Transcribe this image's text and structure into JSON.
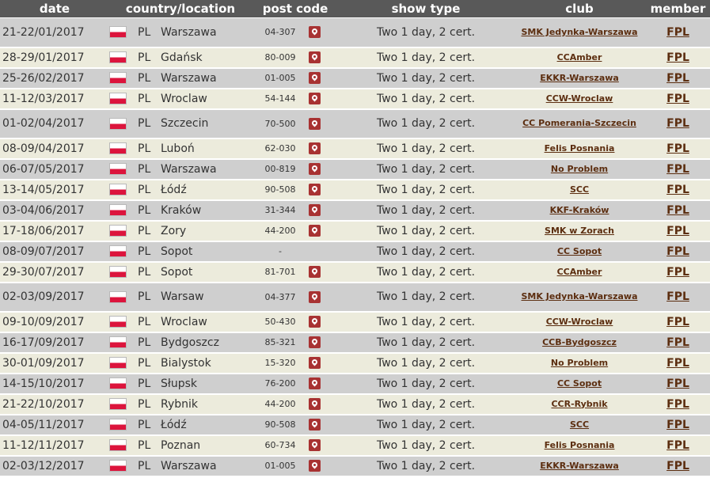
{
  "header": {
    "date": "date",
    "country": "country/location",
    "post": "post code",
    "type": "show type",
    "club": "club",
    "member": "member"
  },
  "colors": {
    "header_bg": "#595959",
    "row_odd": "#cfcfcf",
    "row_even": "#ecebdc",
    "link": "#5c2e10",
    "pin": "#a83232",
    "flag_red": "#dc143c"
  },
  "rows": [
    {
      "date": "21-22/01/2017",
      "country": "PL",
      "city": "Warszawa",
      "post": "04-307",
      "pin": true,
      "type": "Two 1 day, 2 cert.",
      "club": "SMK Jedynka-Warszawa",
      "member": "FPL",
      "tall": true
    },
    {
      "date": "28-29/01/2017",
      "country": "PL",
      "city": "Gdańsk",
      "post": "80-009",
      "pin": true,
      "type": "Two 1 day, 2 cert.",
      "club": "CCAmber",
      "member": "FPL",
      "tall": false
    },
    {
      "date": "25-26/02/2017",
      "country": "PL",
      "city": "Warszawa",
      "post": "01-005",
      "pin": true,
      "type": "Two 1 day, 2 cert.",
      "club": "EKKR-Warszawa",
      "member": "FPL",
      "tall": false
    },
    {
      "date": "11-12/03/2017",
      "country": "PL",
      "city": "Wroclaw",
      "post": "54-144",
      "pin": true,
      "type": "Two 1 day, 2 cert.",
      "club": "CCW-Wroclaw",
      "member": "FPL",
      "tall": false
    },
    {
      "date": "01-02/04/2017",
      "country": "PL",
      "city": "Szczecin",
      "post": "70-500",
      "pin": true,
      "type": "Two 1 day, 2 cert.",
      "club": "CC Pomerania-Szczecin",
      "member": "FPL",
      "tall": true
    },
    {
      "date": "08-09/04/2017",
      "country": "PL",
      "city": "Luboń",
      "post": "62-030",
      "pin": true,
      "type": "Two 1 day, 2 cert.",
      "club": "Felis Posnania",
      "member": "FPL",
      "tall": false
    },
    {
      "date": "06-07/05/2017",
      "country": "PL",
      "city": "Warszawa",
      "post": "00-819",
      "pin": true,
      "type": "Two 1 day, 2 cert.",
      "club": "No Problem",
      "member": "FPL",
      "tall": false
    },
    {
      "date": "13-14/05/2017",
      "country": "PL",
      "city": "Łódź",
      "post": "90-508",
      "pin": true,
      "type": "Two 1 day, 2 cert.",
      "club": "SCC",
      "member": "FPL",
      "tall": false
    },
    {
      "date": "03-04/06/2017",
      "country": "PL",
      "city": "Kraków",
      "post": "31-344",
      "pin": true,
      "type": "Two 1 day, 2 cert.",
      "club": "KKF-Kraków",
      "member": "FPL",
      "tall": false
    },
    {
      "date": "17-18/06/2017",
      "country": "PL",
      "city": "Zory",
      "post": "44-200",
      "pin": true,
      "type": "Two 1 day, 2 cert.",
      "club": "SMK w Zorach",
      "member": "FPL",
      "tall": false
    },
    {
      "date": "08-09/07/2017",
      "country": "PL",
      "city": "Sopot",
      "post": "-",
      "pin": false,
      "type": "Two 1 day, 2 cert.",
      "club": "CC Sopot",
      "member": "FPL",
      "tall": false
    },
    {
      "date": "29-30/07/2017",
      "country": "PL",
      "city": "Sopot",
      "post": "81-701",
      "pin": true,
      "type": "Two 1 day, 2 cert.",
      "club": "CCAmber",
      "member": "FPL",
      "tall": false
    },
    {
      "date": "02-03/09/2017",
      "country": "PL",
      "city": "Warsaw",
      "post": "04-377",
      "pin": true,
      "type": "Two 1 day, 2 cert.",
      "club": "SMK Jedynka-Warszawa",
      "member": "FPL",
      "tall": true
    },
    {
      "date": "09-10/09/2017",
      "country": "PL",
      "city": "Wroclaw",
      "post": "50-430",
      "pin": true,
      "type": "Two 1 day, 2 cert.",
      "club": "CCW-Wroclaw",
      "member": "FPL",
      "tall": false
    },
    {
      "date": "16-17/09/2017",
      "country": "PL",
      "city": "Bydgoszcz",
      "post": "85-321",
      "pin": true,
      "type": "Two 1 day, 2 cert.",
      "club": "CCB-Bydgoszcz",
      "member": "FPL",
      "tall": false
    },
    {
      "date": "30-01/09/2017",
      "country": "PL",
      "city": "Bialystok",
      "post": "15-320",
      "pin": true,
      "type": "Two 1 day, 2 cert.",
      "club": "No Problem",
      "member": "FPL",
      "tall": false
    },
    {
      "date": "14-15/10/2017",
      "country": "PL",
      "city": "Słupsk",
      "post": "76-200",
      "pin": true,
      "type": "Two 1 day, 2 cert.",
      "club": "CC Sopot",
      "member": "FPL",
      "tall": false
    },
    {
      "date": "21-22/10/2017",
      "country": "PL",
      "city": "Rybnik",
      "post": "44-200",
      "pin": true,
      "type": "Two 1 day, 2 cert.",
      "club": "CCR-Rybnik",
      "member": "FPL",
      "tall": false
    },
    {
      "date": "04-05/11/2017",
      "country": "PL",
      "city": "Łódź",
      "post": "90-508",
      "pin": true,
      "type": "Two 1 day, 2 cert.",
      "club": "SCC",
      "member": "FPL",
      "tall": false
    },
    {
      "date": "11-12/11/2017",
      "country": "PL",
      "city": "Poznan",
      "post": "60-734",
      "pin": true,
      "type": "Two 1 day, 2 cert.",
      "club": "Felis Posnania",
      "member": "FPL",
      "tall": false
    },
    {
      "date": "02-03/12/2017",
      "country": "PL",
      "city": "Warszawa",
      "post": "01-005",
      "pin": true,
      "type": "Two 1 day, 2 cert.",
      "club": "EKKR-Warszawa",
      "member": "FPL",
      "tall": false
    }
  ]
}
